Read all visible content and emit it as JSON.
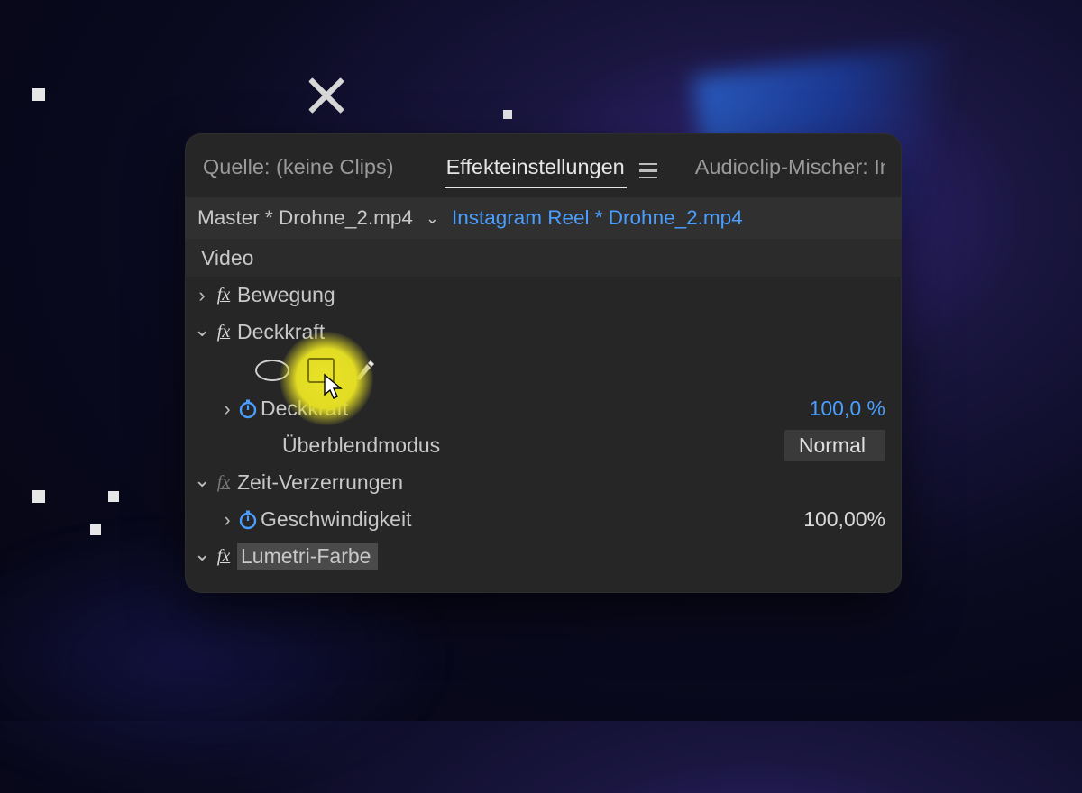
{
  "tabs": {
    "source": "Quelle: (keine Clips)",
    "effects": "Effekteinstellungen",
    "mixer": "Audioclip-Mischer: Insta"
  },
  "crumb": {
    "master": "Master * Drohne_2.mp4",
    "sequence": "Instagram Reel * Drohne_2.mp4"
  },
  "section": {
    "video": "Video"
  },
  "fx": {
    "bewegung": "Bewegung",
    "deckkraft": "Deckkraft",
    "deckkraft_prop": "Deckkraft",
    "deckkraft_val": "100,0 %",
    "blendmode_label": "Überblendmodus",
    "blendmode_val": "Normal",
    "zeit": "Zeit-Verzerrungen",
    "speed_label": "Geschwindigkeit",
    "speed_val": "100,00%",
    "lumetri": "Lumetri-Farbe"
  }
}
